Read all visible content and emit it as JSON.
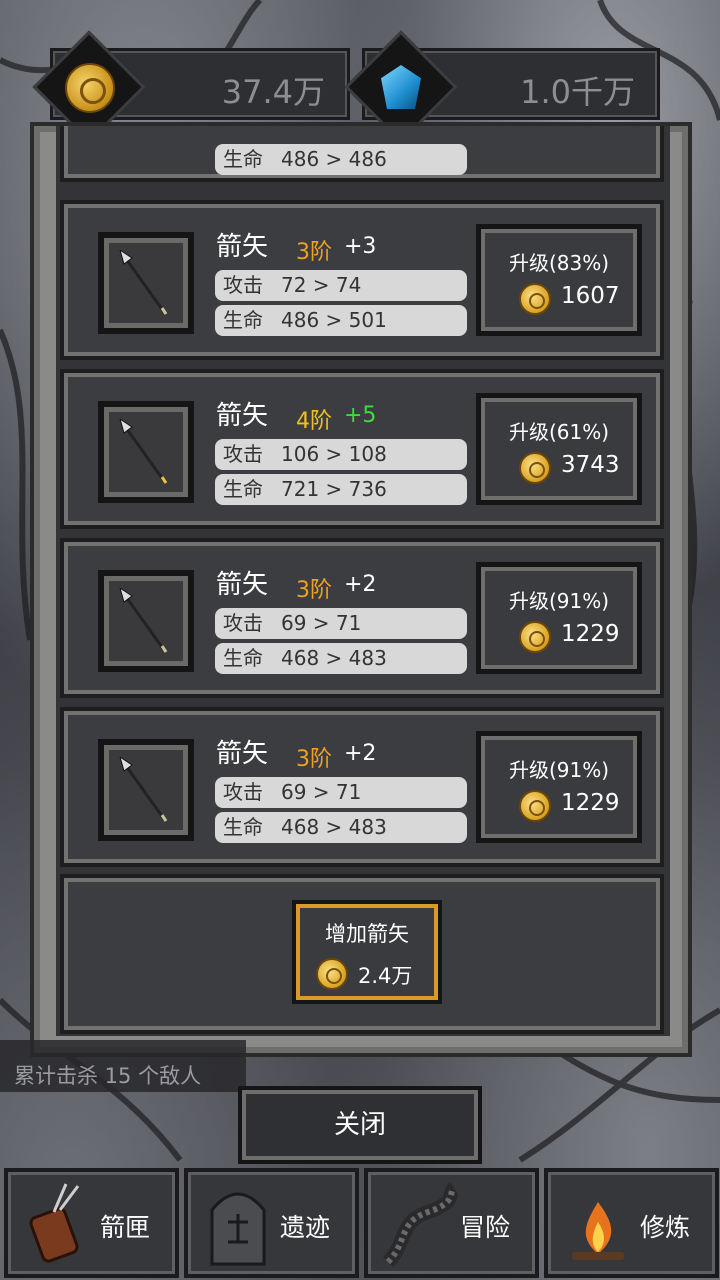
{
  "currency": {
    "gold": "37.4万",
    "gems": "1.0千万"
  },
  "cards": [
    {
      "name": "箭矢",
      "tier": "3阶",
      "tier_color": "#f0a020",
      "plus": "+3",
      "plus_color": "#ffffff",
      "atk_label": "攻击",
      "atk": "72 > 74",
      "hp_label": "生命",
      "hp": "486 > 501",
      "upgrade": "升级(83%)",
      "cost": "1607"
    },
    {
      "name": "箭矢",
      "tier": "4阶",
      "tier_color": "#f0c020",
      "plus": "+5",
      "plus_color": "#3ddc3d",
      "atk_label": "攻击",
      "atk": "106 > 108",
      "hp_label": "生命",
      "hp": "721 > 736",
      "upgrade": "升级(61%)",
      "cost": "3743"
    },
    {
      "name": "箭矢",
      "tier": "3阶",
      "tier_color": "#f0a020",
      "plus": "+2",
      "plus_color": "#ffffff",
      "atk_label": "攻击",
      "atk": "69 > 71",
      "hp_label": "生命",
      "hp": "468 > 483",
      "upgrade": "升级(91%)",
      "cost": "1229"
    },
    {
      "name": "箭矢",
      "tier": "3阶",
      "tier_color": "#f0a020",
      "plus": "+2",
      "plus_color": "#ffffff",
      "atk_label": "攻击",
      "atk": "69 > 71",
      "hp_label": "生命",
      "hp": "468 > 483",
      "upgrade": "升级(91%)",
      "cost": "1229"
    }
  ],
  "partial_card": {
    "hp_label": "生命",
    "hp": "486 > 486"
  },
  "add": {
    "label": "增加箭矢",
    "cost": "2.4万"
  },
  "kills": "累计击杀 15 个敌人",
  "close": "关闭",
  "nav": [
    "箭匣",
    "遗迹",
    "冒险",
    "修炼"
  ]
}
